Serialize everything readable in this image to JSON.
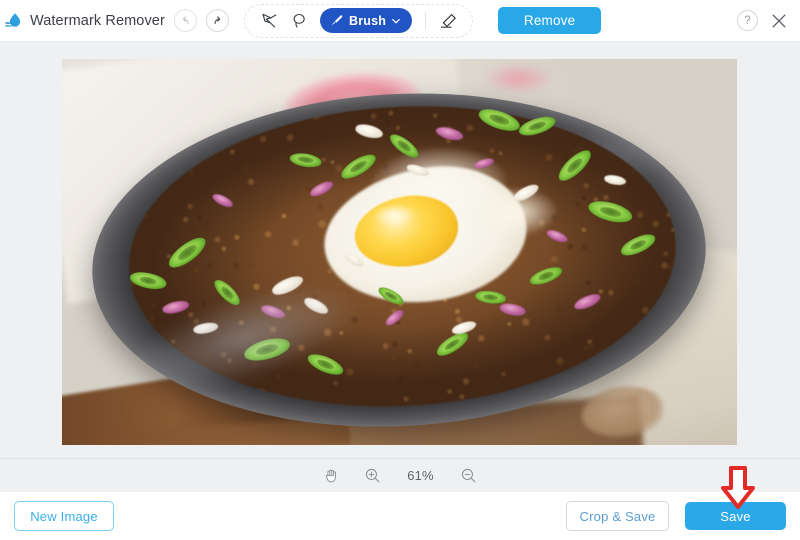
{
  "app": {
    "title": "Watermark Remover",
    "logo_icon": "water-drop-logo"
  },
  "header": {
    "undo_icon": "undo-arrow-icon",
    "redo_icon": "redo-arrow-icon",
    "tools": [
      {
        "name": "polygon-lasso-tool",
        "icon": "polygon-lasso-icon"
      },
      {
        "name": "free-lasso-tool",
        "icon": "lasso-icon"
      }
    ],
    "brush": {
      "label": "Brush",
      "icon": "brush-icon",
      "caret": "chevron-down-icon",
      "color": "#2255c4"
    },
    "eraser": {
      "name": "eraser-tool",
      "icon": "eraser-icon"
    },
    "remove": {
      "label": "Remove",
      "color": "#29a8e8"
    },
    "help_icon": "question-mark-icon",
    "help_glyph": "?",
    "close_icon": "close-x-icon"
  },
  "canvas": {
    "image_alt": "sizzling-sisig-plate-photo",
    "background": "#eff0f2"
  },
  "zoombar": {
    "hand_icon": "hand-pan-icon",
    "zoom_in_icon": "zoom-in-icon",
    "zoom_out_icon": "zoom-out-icon",
    "zoom_level": "61%"
  },
  "footer": {
    "new_image": {
      "label": "New Image"
    },
    "crop_save": {
      "label": "Crop & Save"
    },
    "save": {
      "label": "Save",
      "color": "#2aa8e8"
    }
  },
  "annotation": {
    "arrow_icon": "red-down-arrow-annotation",
    "color": "#e22b26",
    "points_at": "Save"
  }
}
